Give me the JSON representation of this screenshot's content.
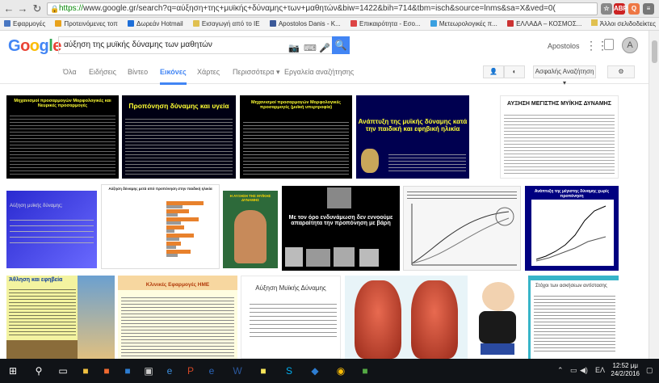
{
  "browser": {
    "url_https": "https://",
    "url_rest": "www.google.gr/search?q=αύξηση+της+μυϊκής+δύναμης+των+μαθητών&biw=1422&bih=714&tbm=isch&source=lnms&sa=X&ved=0(",
    "ext1": "ABP",
    "ext2": "Q"
  },
  "bookmarks": {
    "items": [
      {
        "label": "Εφαρμογές",
        "color": "#4a78c2"
      },
      {
        "label": "Προτεινόμενες τοπ",
        "color": "#e8a21b"
      },
      {
        "label": "Δωρεάν Hotmail",
        "color": "#1e6fd9"
      },
      {
        "label": "Εισαγωγή από το IE",
        "color": "#e0c050"
      },
      {
        "label": "Apostolos Danis - K...",
        "color": "#3b5998"
      },
      {
        "label": "Επικαιρότητα - Εσο...",
        "color": "#d44"
      },
      {
        "label": "Μετεωρολογικές π...",
        "color": "#3aa0e0"
      },
      {
        "label": "ΕΛΛΑΔΑ – ΚΟΣΜΟΣ...",
        "color": "#c33"
      }
    ],
    "other": "Άλλοι σελιδοδείκτες"
  },
  "header": {
    "logo": {
      "g": "G",
      "o1": "o",
      "o2": "o",
      "g2": "g",
      "l": "l",
      "e": "e"
    },
    "query": "αύξηση της μυϊκής δύναμης των μαθητών",
    "user": "Apostolos",
    "avatar": "A"
  },
  "tabs": {
    "all": "Όλα",
    "news": "Ειδήσεις",
    "videos": "Βίντεο",
    "images": "Εικόνες",
    "maps": "Χάρτες",
    "more": "Περισσότερα",
    "tools": "Εργαλεία αναζήτησης"
  },
  "tools": {
    "safesearch": "Ασφαλής Αναζήτηση"
  },
  "images": {
    "r1": {
      "t1": "Μηχανισμοί προσαρμογών Μορφολογικές και Νευρικές προσαρμογές",
      "t2": "Προπόνηση δύναμης και υγεία",
      "t3": "Μηχανισμοί προσαρμογών Μορφολογικές προσαρμογές (μυϊκή υπερτροφία)",
      "t4": "Ανάπτυξη της μυϊκής δύναμης κατά την παιδική και εφηβική ηλικία",
      "t5": "ΑΥΞΗΣΗ ΜΕΓΙΣΤΗΣ ΜΥΪΚΗΣ ΔΥΝΑΜΗΣ"
    },
    "r2": {
      "t1": "Αύξηση μυϊκής δύναμης;",
      "t2": "Αύξηση δύναμης μετά από προπόνηση στην παιδική ηλικία",
      "t3": "Η ΑΥΞΗΣΗ ΤΗΣ ΜΥΪΚΗΣ ΔΥΝΑΜΗΣ",
      "t4": "Με τον όρο ενδυνάμωση δεν εννοούμε απαραίτητα την προπόνηση με βάρη",
      "t6": "Ανάπτυξη της μέγιστης δύναμης χωρίς προπόνηση"
    },
    "r3": {
      "t1": "Άθληση και εφηβεία",
      "t2": "Κλινικές Εφαρμογές ΗΜΕ",
      "t3": "Αύξηση Μυϊκής Δύναμης",
      "t6": "Στόχοι των ασκήσεων αντίστασης"
    }
  },
  "taskbar": {
    "lang": "ΕΛ",
    "time": "12:52 μμ",
    "date": "24/2/2016"
  }
}
